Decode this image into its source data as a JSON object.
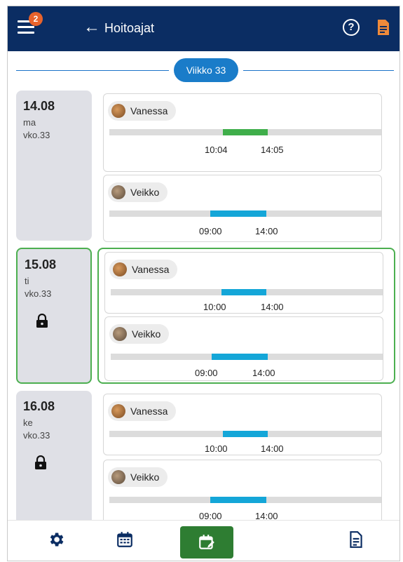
{
  "header": {
    "title": "Hoitoajat",
    "notification_count": "2",
    "help_label": "?"
  },
  "week": {
    "label": "Viikko 33"
  },
  "days": [
    {
      "date": "14.08",
      "weekday": "ma",
      "week": "vko.33",
      "locked": false,
      "selected": false,
      "shifts": [
        {
          "name": "Vanessa",
          "start": "10:04",
          "end": "14:05",
          "color": "#3fae4a"
        },
        {
          "name": "Veikko",
          "start": "09:00",
          "end": "14:00",
          "color": "#14a6d8"
        }
      ]
    },
    {
      "date": "15.08",
      "weekday": "ti",
      "week": "vko.33",
      "locked": true,
      "selected": true,
      "shifts": [
        {
          "name": "Vanessa",
          "start": "10:00",
          "end": "14:00",
          "color": "#14a6d8"
        },
        {
          "name": "Veikko",
          "start": "09:00",
          "end": "14:00",
          "color": "#14a6d8"
        }
      ]
    },
    {
      "date": "16.08",
      "weekday": "ke",
      "week": "vko.33",
      "locked": true,
      "selected": false,
      "shifts": [
        {
          "name": "Vanessa",
          "start": "10:00",
          "end": "14:00",
          "color": "#14a6d8"
        },
        {
          "name": "Veikko",
          "start": "09:00",
          "end": "14:00",
          "color": "#14a6d8"
        }
      ]
    }
  ],
  "bottom_nav": [
    {
      "icon": "gear-icon"
    },
    {
      "icon": "calendar-grid-icon"
    },
    {
      "icon": "calendar-edit-icon",
      "active": true
    },
    {
      "icon": "document-icon"
    }
  ]
}
